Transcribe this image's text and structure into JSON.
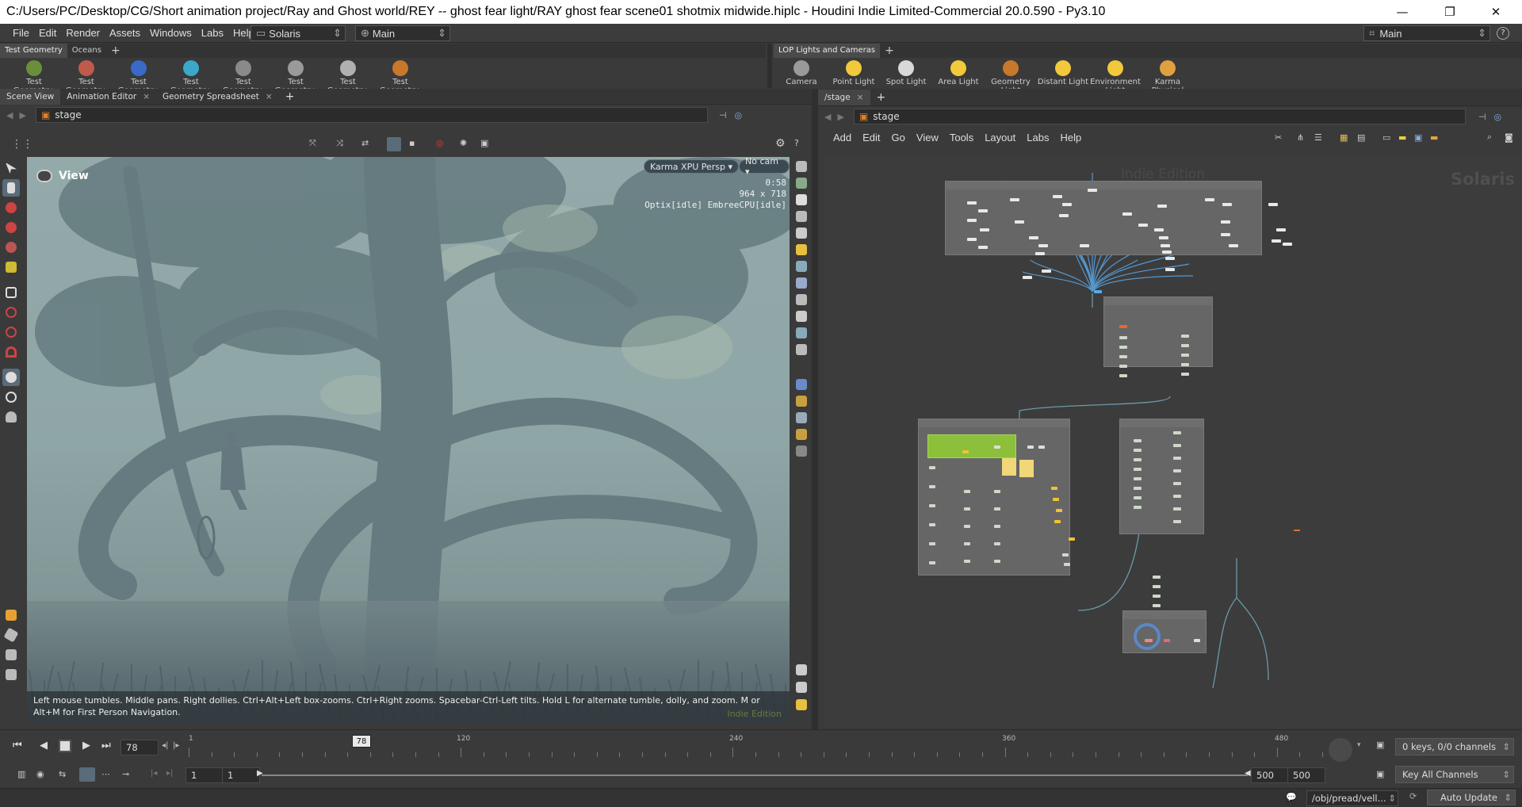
{
  "window": {
    "title": "C:/Users/PC/Desktop/CG/Short animation project/Ray and Ghost world/REY -- ghost fear light/RAY ghost fear scene01 shotmix midwide.hiplc - Houdini Indie Limited-Commercial 20.0.590 - Py3.10",
    "minimize": "—",
    "maximize": "❐",
    "close": "✕"
  },
  "menubar": {
    "items": [
      "File",
      "Edit",
      "Render",
      "Assets",
      "Windows",
      "Labs",
      "Help"
    ],
    "desktop": "Solaris",
    "runtime": "Main",
    "desktop_right": "Main",
    "help": "?"
  },
  "shelf_left": {
    "tabs": [
      "Test Geometry",
      "Oceans"
    ],
    "add": "+",
    "tools": [
      {
        "line1": "Test",
        "line2": "Geometry: C...",
        "color": "#6a8f3a"
      },
      {
        "line1": "Test",
        "line2": "Geometry: P...",
        "color": "#c05a4a"
      },
      {
        "line1": "Test",
        "line2": "Geometry: R...",
        "color": "#3a6ac8"
      },
      {
        "line1": "Test",
        "line2": "Geometry: S...",
        "color": "#3aa8c8"
      },
      {
        "line1": "Test",
        "line2": "Geometry: S...",
        "color": "#8a8a8a"
      },
      {
        "line1": "Test",
        "line2": "Geometry: T...",
        "color": "#9a9a9a"
      },
      {
        "line1": "Test",
        "line2": "Geometry: T...",
        "color": "#b0b0b0"
      },
      {
        "line1": "Test",
        "line2": "Geometry: T...",
        "color": "#c8782a"
      }
    ]
  },
  "shelf_right": {
    "tabs": [
      "LOP Lights and Cameras"
    ],
    "add": "+",
    "tools": [
      {
        "line1": "Camera",
        "line2": "",
        "color": "#9a9a9a"
      },
      {
        "line1": "Point Light",
        "line2": "",
        "color": "#f2c93a"
      },
      {
        "line1": "Spot Light",
        "line2": "",
        "color": "#d8d8d8"
      },
      {
        "line1": "Area Light",
        "line2": "",
        "color": "#f2c93a"
      },
      {
        "line1": "Geometry",
        "line2": "Light",
        "color": "#c8782a"
      },
      {
        "line1": "Distant Light",
        "line2": "",
        "color": "#f2c93a"
      },
      {
        "line1": "Environment",
        "line2": "Light",
        "color": "#f2c93a"
      },
      {
        "line1": "Karma",
        "line2": "Physical Sky...",
        "color": "#e0a040"
      }
    ]
  },
  "left_pane": {
    "tabs": [
      "Scene View",
      "Animation Editor",
      "Geometry Spreadsheet"
    ],
    "add": "+",
    "path": "stage",
    "view_label": "View",
    "renderer": "Karma XPU  Persp ▾",
    "camera": "No cam ▾",
    "hud": [
      "0:58",
      "964 x 718",
      "Optix[idle] EmbreeCPU[idle]"
    ],
    "status": "Left mouse tumbles. Middle pans. Right dollies. Ctrl+Alt+Left box-zooms. Ctrl+Right zooms. Spacebar-Ctrl-Left tilts. Hold L for alternate tumble, dolly, and zoom. M or Alt+M for First Person Navigation.",
    "watermark": "Indie Edition"
  },
  "right_pane": {
    "tab": "/stage",
    "add": "+",
    "path": "stage",
    "menu": [
      "Add",
      "Edit",
      "Go",
      "View",
      "Tools",
      "Layout",
      "Labs",
      "Help"
    ],
    "watermark_center": "Indie Edition",
    "watermark_right": "Solaris"
  },
  "timeline": {
    "current_frame": "78",
    "marker": "78",
    "ticks": [
      "1",
      "120",
      "240",
      "360",
      "480"
    ],
    "start": "1",
    "start2": "1",
    "end": "500",
    "end2": "500",
    "keys": "0 keys, 0/0 channels",
    "key_all": "Key All Channels"
  },
  "statusbar": {
    "path": "/obj/pread/vell...",
    "update": "Auto Update"
  },
  "colors": {
    "accent_green": "#8cbf3a",
    "sticky_yellow": "#f0d878",
    "node_yellow": "#f2c230",
    "wire_blue": "#5aa8e8"
  }
}
